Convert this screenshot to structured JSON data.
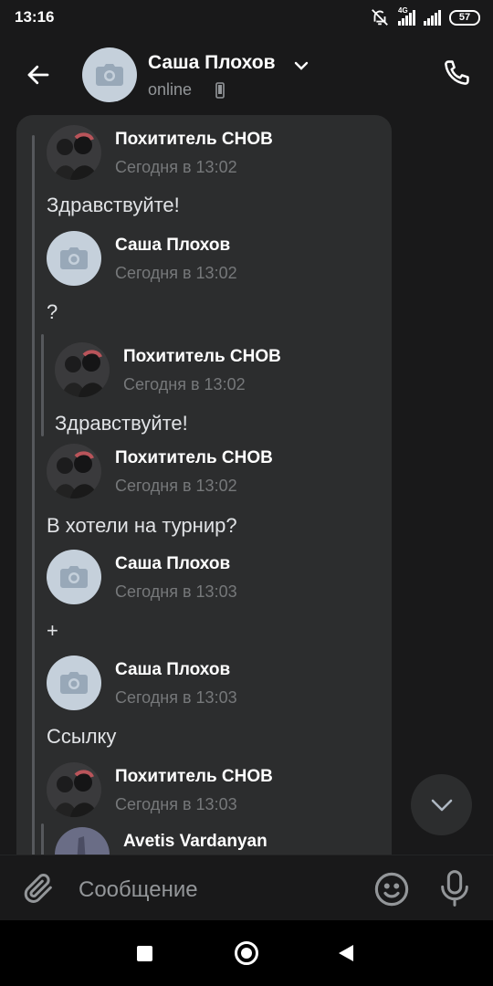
{
  "status_bar": {
    "time": "13:16",
    "network": "4G",
    "battery": "57"
  },
  "header": {
    "contact_name": "Саша Плохов",
    "status": "online"
  },
  "messages": [
    {
      "author": "Похититель СНОВ",
      "date": "Сегодня в 13:02",
      "text": "Здравствуйте!"
    },
    {
      "author": "Саша Плохов",
      "date": "Сегодня в 13:02",
      "text": "?"
    },
    {
      "author": "Похититель СНОВ",
      "date": "Сегодня в 13:02",
      "text": "Здравствуйте!"
    },
    {
      "author": "Похититель СНОВ",
      "date": "Сегодня в 13:02",
      "text": "В хотели на турнир?"
    },
    {
      "author": "Саша Плохов",
      "date": "Сегодня в 13:03",
      "text": "+"
    },
    {
      "author": "Саша Плохов",
      "date": "Сегодня в 13:03",
      "text": "Ссылку"
    },
    {
      "author": "Похититель СНОВ",
      "date": "Сегодня в 13:03",
      "text": ""
    },
    {
      "author": "Avetis Vardanyan",
      "date": "",
      "text": ""
    }
  ],
  "composer": {
    "placeholder": "Сообщение"
  },
  "colors": {
    "background": "#19191a",
    "bubble": "#2c2d2e",
    "accent_avatar": "#c5d0db",
    "secondary_text": "#76787a"
  },
  "icons": [
    "back-arrow-icon",
    "camera-icon",
    "chevron-down-icon",
    "phone-icon",
    "paperclip-icon",
    "emoji-icon",
    "microphone-icon"
  ]
}
